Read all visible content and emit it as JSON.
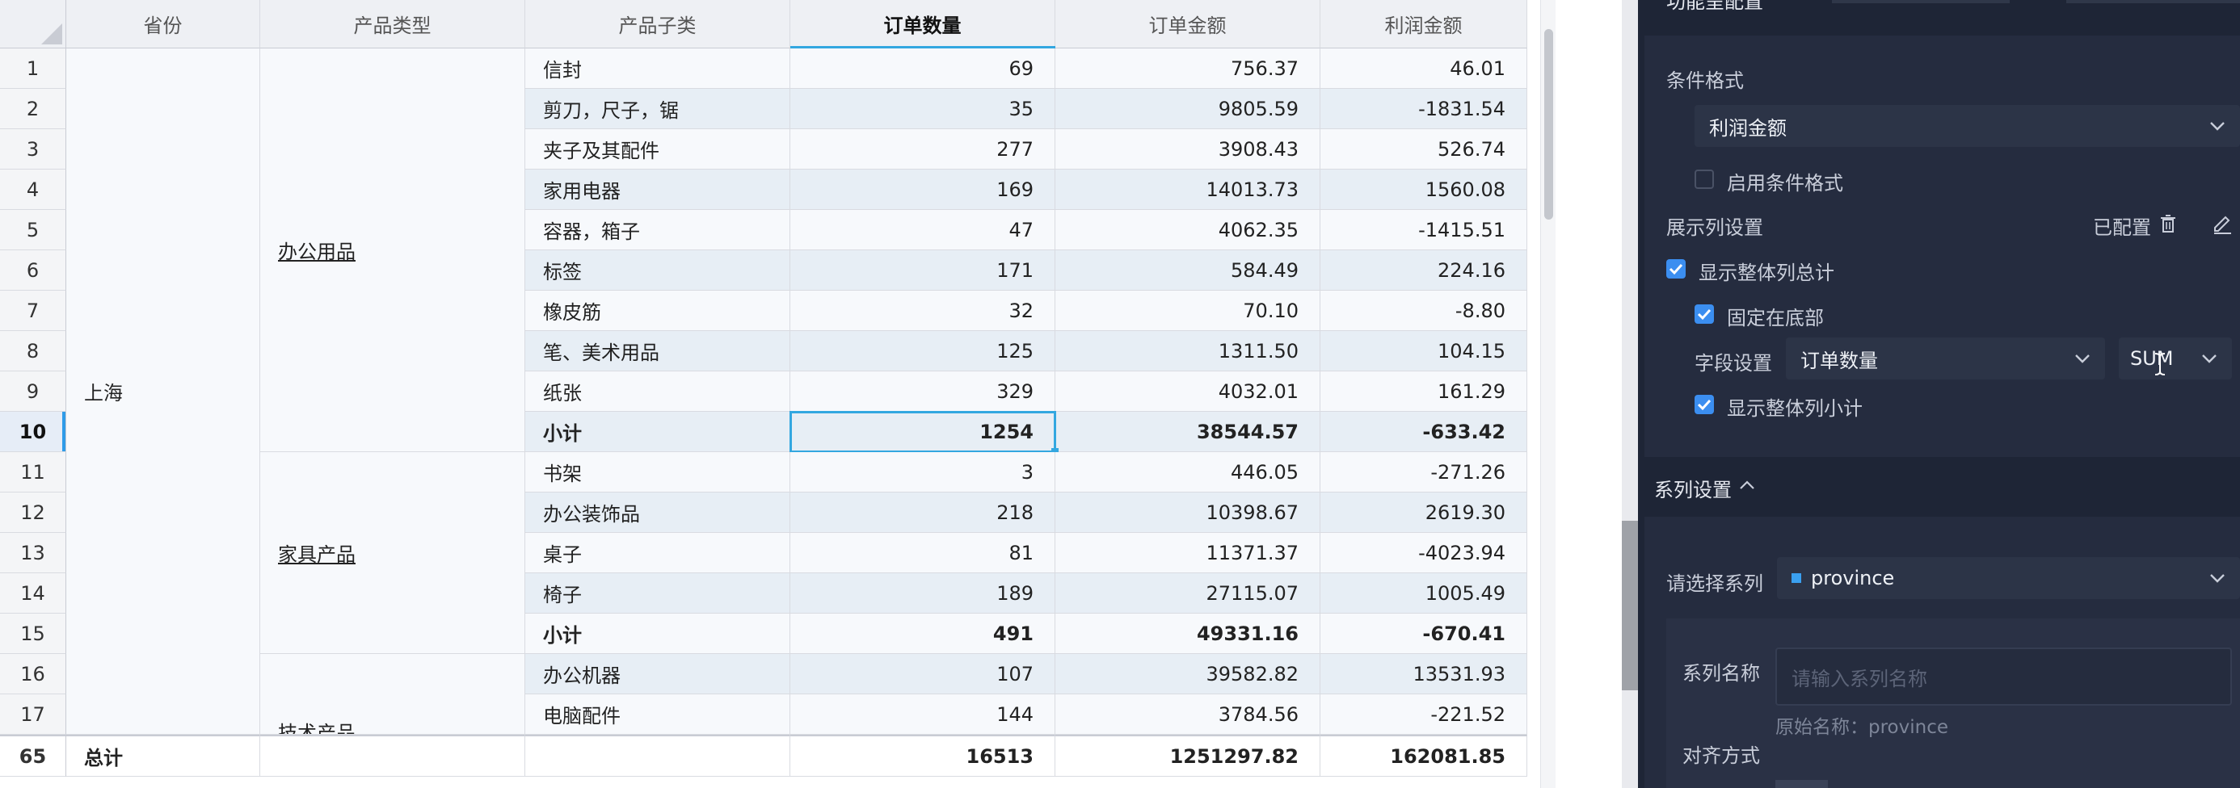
{
  "table": {
    "columns": [
      "省份",
      "产品类型",
      "产品子类",
      "订单数量",
      "订单金额",
      "利润金额"
    ],
    "province": "上海",
    "groups": [
      {
        "name": "办公用品",
        "row_start": 0,
        "row_end": 9
      },
      {
        "name": "家具产品",
        "row_start": 10,
        "row_end": 14
      },
      {
        "name": "技术产品",
        "row_start": 15,
        "row_end": 16
      }
    ],
    "rows": [
      {
        "num": "1",
        "sub": "信封",
        "qty": "69",
        "amt": "756.37",
        "profit": "46.01"
      },
      {
        "num": "2",
        "sub": "剪刀，尺子，锯",
        "qty": "35",
        "amt": "9805.59",
        "profit": "-1831.54"
      },
      {
        "num": "3",
        "sub": "夹子及其配件",
        "qty": "277",
        "amt": "3908.43",
        "profit": "526.74"
      },
      {
        "num": "4",
        "sub": "家用电器",
        "qty": "169",
        "amt": "14013.73",
        "profit": "1560.08"
      },
      {
        "num": "5",
        "sub": "容器，箱子",
        "qty": "47",
        "amt": "4062.35",
        "profit": "-1415.51"
      },
      {
        "num": "6",
        "sub": "标签",
        "qty": "171",
        "amt": "584.49",
        "profit": "224.16"
      },
      {
        "num": "7",
        "sub": "橡皮筋",
        "qty": "32",
        "amt": "70.10",
        "profit": "-8.80"
      },
      {
        "num": "8",
        "sub": "笔、美术用品",
        "qty": "125",
        "amt": "1311.50",
        "profit": "104.15"
      },
      {
        "num": "9",
        "sub": "纸张",
        "qty": "329",
        "amt": "4032.01",
        "profit": "161.29"
      },
      {
        "num": "10",
        "sub": "小计",
        "qty": "1254",
        "amt": "38544.57",
        "profit": "-633.42",
        "subtotal": true,
        "selected": true
      },
      {
        "num": "11",
        "sub": "书架",
        "qty": "3",
        "amt": "446.05",
        "profit": "-271.26"
      },
      {
        "num": "12",
        "sub": "办公装饰品",
        "qty": "218",
        "amt": "10398.67",
        "profit": "2619.30"
      },
      {
        "num": "13",
        "sub": "桌子",
        "qty": "81",
        "amt": "11371.37",
        "profit": "-4023.94"
      },
      {
        "num": "14",
        "sub": "椅子",
        "qty": "189",
        "amt": "27115.07",
        "profit": "1005.49"
      },
      {
        "num": "15",
        "sub": "小计",
        "qty": "491",
        "amt": "49331.16",
        "profit": "-670.41",
        "subtotal": true
      },
      {
        "num": "16",
        "sub": "办公机器",
        "qty": "107",
        "amt": "39582.82",
        "profit": "13531.93"
      },
      {
        "num": "17",
        "sub": "电脑配件",
        "qty": "144",
        "amt": "3784.56",
        "profit": "-221.52"
      }
    ],
    "total": {
      "num": "65",
      "label": "总计",
      "qty": "16513",
      "amt": "1251297.82",
      "profit": "162081.85"
    }
  },
  "panel": {
    "top_title": "功能呈配置",
    "cond_format": {
      "label": "条件格式",
      "field": "利润金额",
      "enable_label": "启用条件格式",
      "enabled": false
    },
    "display_cols": {
      "label": "展示列设置",
      "configured": "已配置",
      "show_total_label": "显示整体列总计",
      "show_total": true,
      "fix_bottom_label": "固定在底部",
      "fix_bottom": true,
      "field_label": "字段设置",
      "field_value": "订单数量",
      "agg_value": "SUM",
      "show_subtotal_label": "显示整体列小计",
      "show_subtotal": true
    },
    "series": {
      "header": "系列设置",
      "select_label": "请选择系列",
      "selected_series": "province",
      "name_label": "系列名称",
      "name_placeholder": "请输入系列名称",
      "original_name": "原始名称：province",
      "align_label": "对齐方式"
    },
    "colors": {
      "accent": "#3b8ef0",
      "panel_bg": "#1e2536",
      "selection": "#33a7e0"
    }
  }
}
